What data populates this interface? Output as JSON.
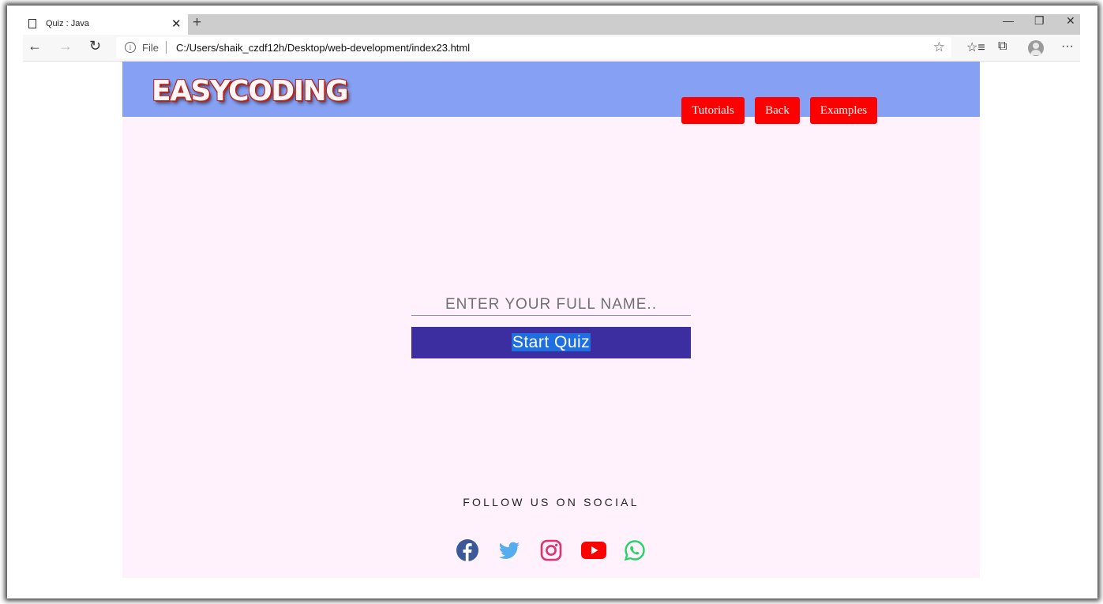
{
  "browser": {
    "tab_title": "Quiz : Java",
    "new_tab": "+",
    "tab_close": "✕",
    "address_scheme": "File",
    "address_url": "C:/Users/shaik_czdf12h/Desktop/web-development/index23.html"
  },
  "header": {
    "logo": "EASYCODING",
    "nav": [
      "Tutorials",
      "Back",
      "Examples"
    ],
    "background": "#86a0f3",
    "button_color": "#ff0000"
  },
  "quiz": {
    "name_placeholder": "ENTER YOUR FULL NAME..",
    "name_value": "",
    "start_label": "Start Quiz"
  },
  "footer": {
    "follow_text": "FOLLOW US ON SOCIAL",
    "social_icons": [
      "facebook-icon",
      "twitter-icon",
      "instagram-icon",
      "youtube-icon",
      "whatsapp-icon"
    ]
  }
}
